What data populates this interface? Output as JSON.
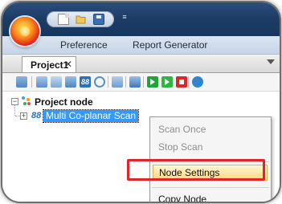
{
  "ribbon": {
    "menus": [
      "Preference",
      "Report Generator"
    ],
    "qat_dropdown": "≡"
  },
  "tabs": [
    {
      "label": "Project1",
      "close": "✕"
    }
  ],
  "tree": {
    "root_label": "Project node",
    "root_expander": "−",
    "child_label": "Multi Co-planar Scan",
    "child_expander": "+",
    "child_icon_text": "88"
  },
  "toolbar": {
    "scan_icon_text": "88"
  },
  "context_menu": {
    "items": [
      {
        "label": "Scan Once",
        "enabled": false
      },
      {
        "label": "Stop Scan",
        "enabled": false
      },
      {
        "label": "Node Settings",
        "enabled": true,
        "highlighted": true
      },
      {
        "label": "Copy Node",
        "enabled": true
      }
    ]
  },
  "colors": {
    "highlight_box": "#e2232a",
    "selection": "#3399ff",
    "menu_hover": "#ffd97a"
  }
}
